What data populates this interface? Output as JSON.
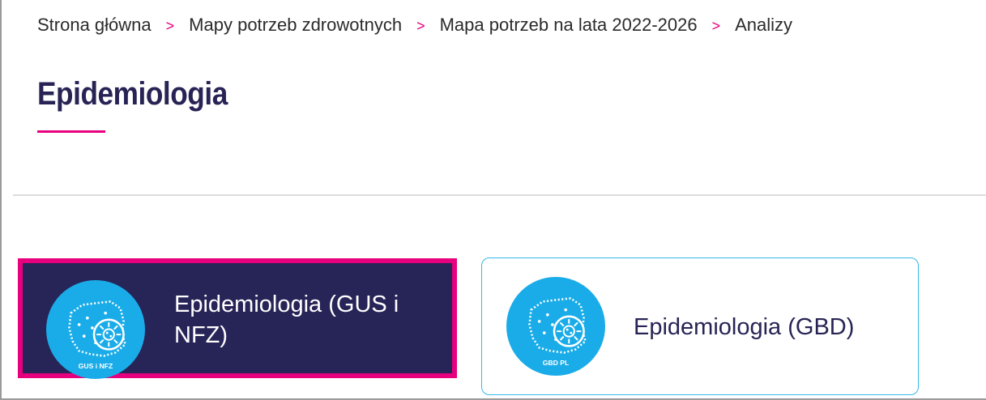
{
  "breadcrumb": {
    "items": [
      {
        "label": "Strona główna"
      },
      {
        "label": "Mapy potrzeb zdrowotnych"
      },
      {
        "label": "Mapa potrzeb na lata 2022-2026"
      },
      {
        "label": "Analizy"
      }
    ],
    "separator": ">"
  },
  "page": {
    "title": "Epidemiologia"
  },
  "tiles": [
    {
      "label": "Epidemiologia (GUS i NFZ)",
      "badge": "GUS i NFZ",
      "icon": "poland-map-virus-icon",
      "selected": true
    },
    {
      "label": "Epidemiologia (GBD)",
      "badge": "GBD PL",
      "icon": "poland-map-virus-icon",
      "selected": false
    }
  ],
  "colors": {
    "accent": "#e6007e",
    "navy": "#272457",
    "icon_blue": "#1aace8",
    "tile_border": "#36b8e8"
  }
}
